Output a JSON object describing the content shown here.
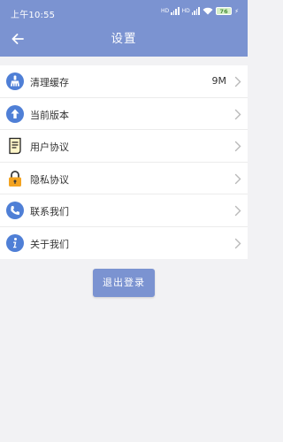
{
  "status_bar": {
    "time": "上午10:55",
    "hd_label": "HD",
    "battery": "76"
  },
  "header": {
    "title": "设置",
    "back_icon": "arrow-left-icon"
  },
  "settings": {
    "items": [
      {
        "label": "清理缓存",
        "value": "9M",
        "icon": "broom-icon"
      },
      {
        "label": "当前版本",
        "value": "",
        "icon": "upload-arrow-icon"
      },
      {
        "label": "用户协议",
        "value": "",
        "icon": "document-icon"
      },
      {
        "label": "隐私协议",
        "value": "",
        "icon": "lock-icon"
      },
      {
        "label": "联系我们",
        "value": "",
        "icon": "phone-icon"
      },
      {
        "label": "关于我们",
        "value": "",
        "icon": "info-icon"
      }
    ]
  },
  "logout_label": "退出登录",
  "colors": {
    "accent": "#7b93d1",
    "icon_blue": "#4f7fd6",
    "lock_orange": "#f3a321",
    "background": "#f2f2f4"
  }
}
